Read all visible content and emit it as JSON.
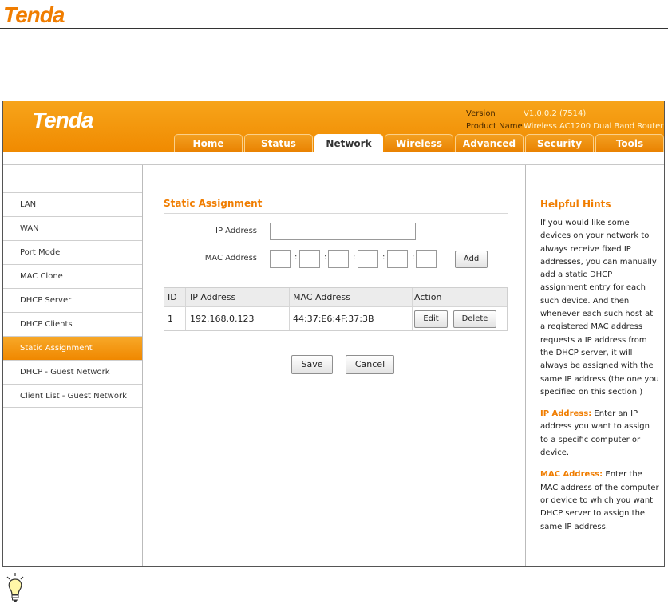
{
  "document": {
    "logo_text": "Tenda"
  },
  "header": {
    "logo_text": "Tenda",
    "version_label": "Version",
    "version_value": "V1.0.0.2 (7514)",
    "product_label": "Product Name",
    "product_value": "Wireless AC1200 Dual Band Router"
  },
  "tabs": [
    {
      "label": "Home"
    },
    {
      "label": "Status"
    },
    {
      "label": "Network",
      "active": true
    },
    {
      "label": "Wireless"
    },
    {
      "label": "Advanced"
    },
    {
      "label": "Security"
    },
    {
      "label": "Tools"
    }
  ],
  "sidebar": {
    "items": [
      {
        "label": "LAN"
      },
      {
        "label": "WAN"
      },
      {
        "label": "Port Mode"
      },
      {
        "label": "MAC Clone"
      },
      {
        "label": "DHCP Server"
      },
      {
        "label": "DHCP Clients"
      },
      {
        "label": "Static Assignment",
        "active": true
      },
      {
        "label": "DHCP - Guest Network"
      },
      {
        "label": "Client List - Guest Network"
      }
    ]
  },
  "main": {
    "section_title": "Static Assignment",
    "ip_label": "IP Address",
    "ip_value": "",
    "mac_label": "MAC Address",
    "mac_values": [
      "",
      "",
      "",
      "",
      "",
      ""
    ],
    "mac_separator": ":",
    "add_button": "Add",
    "table": {
      "headers": [
        "ID",
        "IP Address",
        "MAC Address",
        "Action"
      ],
      "rows": [
        {
          "id": "1",
          "ip": "192.168.0.123",
          "mac": "44:37:E6:4F:37:3B",
          "edit": "Edit",
          "delete": "Delete"
        }
      ]
    },
    "save_button": "Save",
    "cancel_button": "Cancel"
  },
  "hints": {
    "title": "Helpful Hints",
    "intro": "If you would like some devices on your network to always receive fixed IP addresses, you can manually add a static DHCP assignment entry for each such device. And then whenever each such host at a registered MAC address requests a IP address from the DHCP server, it will always be assigned with the same IP address (the one you specified on this section )",
    "ip_term": "IP Address:",
    "ip_desc": "Enter an IP address you want to assign to a specific computer or device.",
    "mac_term": "MAC Address:",
    "mac_desc": "Enter the MAC address of the computer or device to which you want DHCP server to assign the same IP address."
  },
  "colors": {
    "brand_orange": "#f07d00",
    "tab_orange": "#e98100"
  },
  "icons": {
    "note": "lightbulb-icon"
  }
}
